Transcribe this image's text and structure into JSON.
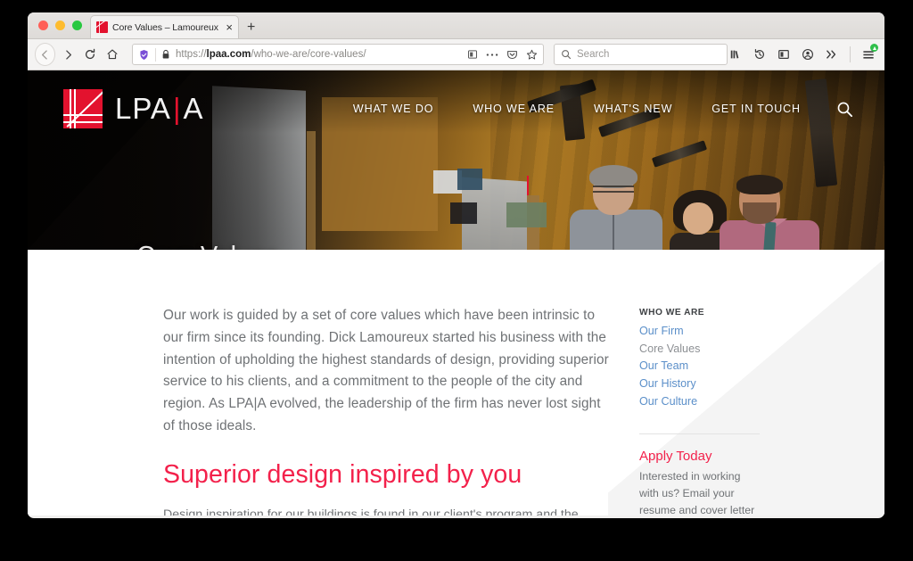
{
  "browser": {
    "tab": {
      "title": "Core Values – Lamoureux Pag",
      "close_label": "×",
      "favicon_name": "lpaa-favicon"
    },
    "new_tab_label": "+",
    "nav": {
      "back_label": "←",
      "forward_label": "→",
      "reload_label": "↻",
      "home_label": "⌂"
    },
    "url": {
      "scheme": "https://",
      "domain": "lpaa.com",
      "path": "/who-we-are/core-values/",
      "full": "https://lpaa.com/who-we-are/core-values/"
    },
    "search": {
      "placeholder": "Search"
    },
    "toolbar_icons": [
      "library-icon",
      "history-icon",
      "sidebar-icon",
      "account-icon",
      "overflow-chevrons-icon",
      "hamburger-menu-icon"
    ]
  },
  "site": {
    "logo": {
      "letters_left": "LPA",
      "pipe": "|",
      "letters_right": "A",
      "mark_name": "lpaa-logo-mark"
    },
    "nav": [
      {
        "label": "WHAT WE DO"
      },
      {
        "label": "WHO WE ARE"
      },
      {
        "label": "WHAT'S NEW"
      },
      {
        "label": "GET IN TOUCH"
      }
    ],
    "search_icon": "search-icon",
    "hero": {
      "title": "Core Values"
    }
  },
  "content": {
    "intro": "Our work is guided by a set of core values which have been intrinsic to our firm since its founding. Dick Lamoureux started his business with the intention of upholding the highest standards of design, providing superior service to his clients, and a commitment to the people of the city and region. As LPA|A evolved, the leadership of the firm has never lost sight of those ideals.",
    "headline": "Superior design inspired by you",
    "body": "Design inspiration for our buildings is found in our client's program and the context of the site. Our buildings respond to current needs and future use, drawing on the principles of"
  },
  "sidebar": {
    "kicker": "WHO WE ARE",
    "links": [
      {
        "label": "Our Firm",
        "current": false
      },
      {
        "label": "Core Values",
        "current": true
      },
      {
        "label": "Our Team",
        "current": false
      },
      {
        "label": "Our History",
        "current": false
      },
      {
        "label": "Our Culture",
        "current": false
      }
    ],
    "apply": {
      "title": "Apply Today",
      "text": "Interested in working with us? Email your resume and cover letter to Andree Witkos at"
    }
  },
  "colors": {
    "brand_red": "#e3122e",
    "headline_red": "#f3214b",
    "link_blue": "#5b8fc9",
    "body_gray": "#6f7275"
  }
}
